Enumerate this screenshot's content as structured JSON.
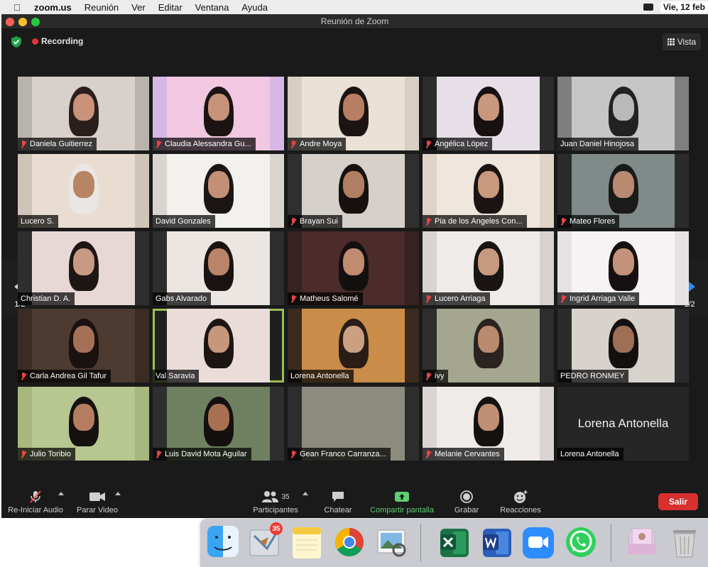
{
  "menubar": {
    "app": "zoom.us",
    "items": [
      "Reunión",
      "Ver",
      "Editar",
      "Ventana",
      "Ayuda"
    ],
    "date": "Vie, 12 feb"
  },
  "window": {
    "title": "Reunión de Zoom",
    "recording_label": "Recording",
    "view_label": "Vista"
  },
  "gallery": {
    "page": "1/2",
    "tiles": [
      {
        "name": "Daniela Guitierrez",
        "muted": true
      },
      {
        "name": "Claudia Alessandra Gu...",
        "muted": true
      },
      {
        "name": "Andre Moya",
        "muted": true
      },
      {
        "name": "Angélica López",
        "muted": true
      },
      {
        "name": "Juan Daniel Hinojosa",
        "muted": false
      },
      {
        "name": "Lucero S.",
        "muted": false
      },
      {
        "name": "David Gonzales",
        "muted": false
      },
      {
        "name": "Brayan Sui",
        "muted": true
      },
      {
        "name": "Pia de los Ángeles Con...",
        "muted": true
      },
      {
        "name": "Mateo Flores",
        "muted": true
      },
      {
        "name": "Christian D. A.",
        "muted": false
      },
      {
        "name": "Gabs Alvarado",
        "muted": false
      },
      {
        "name": "Matheus Salomé",
        "muted": true
      },
      {
        "name": "Lucero Arriaga",
        "muted": true
      },
      {
        "name": "Ingrid Arriaga Valle",
        "muted": true
      },
      {
        "name": "Carla Andrea Gil Tafur",
        "muted": true
      },
      {
        "name": "Val Saravia",
        "muted": false,
        "active": true
      },
      {
        "name": "Lorena Antonella",
        "muted": false
      },
      {
        "name": "ivy",
        "muted": true
      },
      {
        "name": "PEDRO RONMEY",
        "muted": false
      },
      {
        "name": "Julio Toribio",
        "muted": true
      },
      {
        "name": "Luis David Mota Aguilar",
        "muted": true
      },
      {
        "name": "Gean Franco Carranza...",
        "muted": true
      },
      {
        "name": "Melanie Cervantes",
        "muted": true
      },
      {
        "name": "Lorena Antonella",
        "muted": false,
        "no_video": true
      }
    ]
  },
  "toolbar": {
    "audio_label": "Re-Iniciar Audio",
    "video_label": "Parar Video",
    "participants_label": "Participantes",
    "participants_count": "35",
    "chat_label": "Chatear",
    "share_label": "Compartir pantalla",
    "record_label": "Grabar",
    "reactions_label": "Reacciones",
    "leave_label": "Salir"
  },
  "dock": {
    "apps": [
      "finder-icon",
      "mail-icon",
      "notes-icon",
      "chrome-icon",
      "preview-icon",
      "excel-icon",
      "word-icon",
      "zoom-icon",
      "whatsapp-icon",
      "photos-folder-icon",
      "trash-icon"
    ],
    "mail_badge": "35"
  },
  "colors": {
    "share_green": "#5ecd73",
    "leave_red": "#d8302f",
    "active_speaker": "#9bbf57",
    "zoom_blue": "#2d8cff"
  }
}
